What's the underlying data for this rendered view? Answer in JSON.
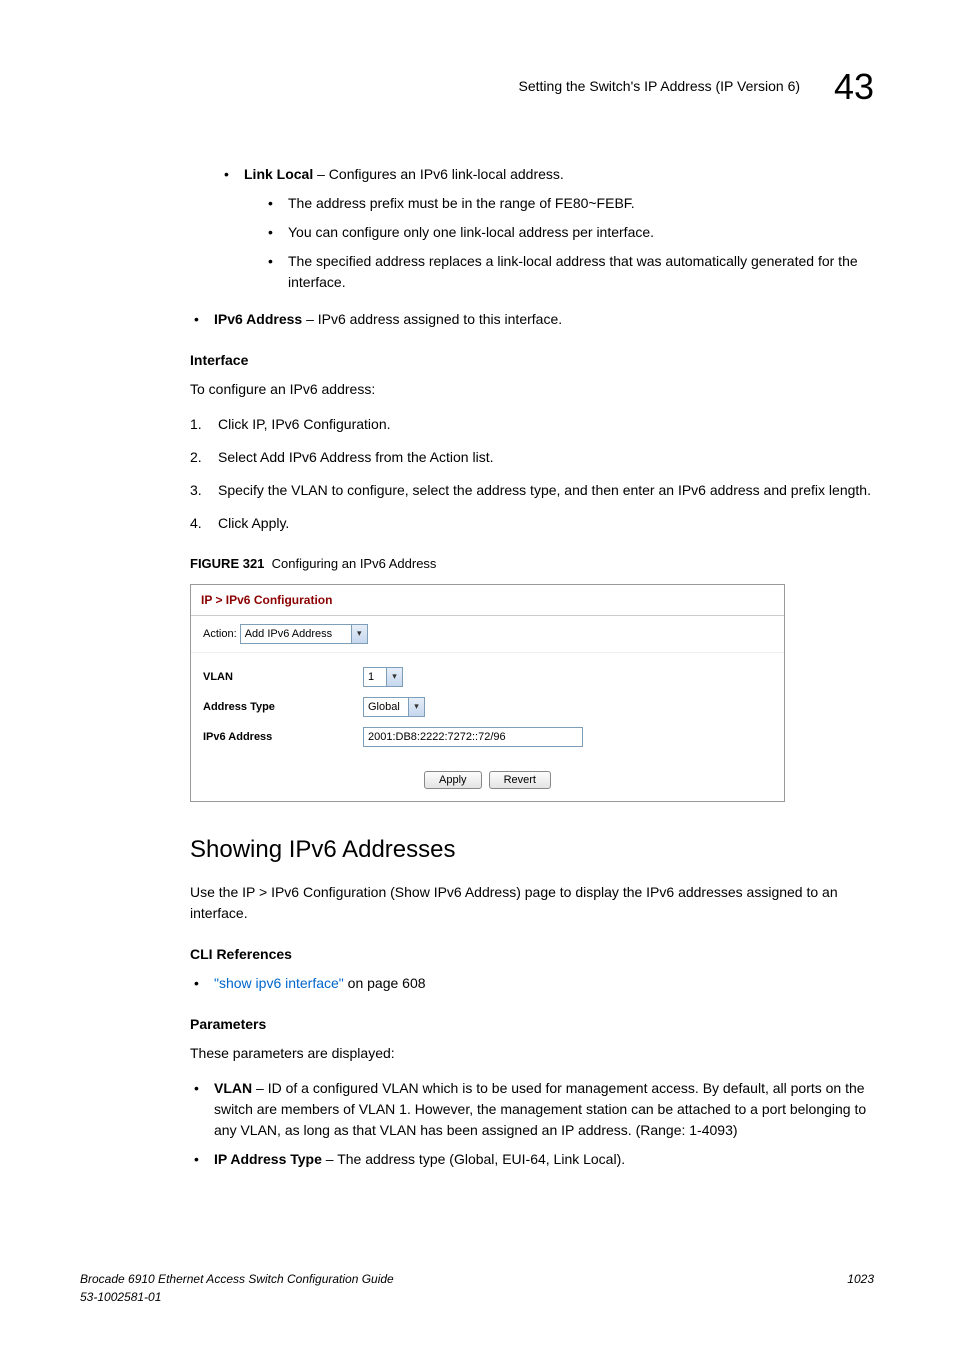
{
  "header": {
    "title": "Setting the Switch's IP Address (IP Version 6)",
    "chapter": "43"
  },
  "top_bullets": {
    "link_local_label": "Link Local",
    "link_local_desc": " – Configures an IPv6 link-local address.",
    "sub1": "The address prefix must be in the range of FE80~FEBF.",
    "sub2": "You can configure only one link-local address per interface.",
    "sub3": "The specified address replaces a link-local address that was automatically generated for the interface.",
    "ipv6_addr_label": "IPv6 Address",
    "ipv6_addr_desc": " – IPv6 address assigned to this interface."
  },
  "interface_section": {
    "heading": "Interface",
    "intro": "To configure an IPv6 address:",
    "steps": {
      "s1": "Click IP, IPv6 Configuration.",
      "s2": "Select Add IPv6 Address from the Action list.",
      "s3": "Specify the VLAN to configure, select the address type, and then enter an IPv6 address and prefix length.",
      "s4": "Click Apply."
    }
  },
  "figure": {
    "caption_prefix": "FIGURE 321",
    "caption_text": "Configuring an IPv6 Address",
    "breadcrumb": "IP > IPv6 Configuration",
    "action_label": "Action:",
    "action_value": "Add IPv6 Address",
    "vlan_label": "VLAN",
    "vlan_value": "1",
    "addrtype_label": "Address Type",
    "addrtype_value": "Global",
    "ipv6addr_label": "IPv6 Address",
    "ipv6addr_value": "2001:DB8:2222:7272::72/96",
    "apply": "Apply",
    "revert": "Revert"
  },
  "showing_section": {
    "heading": "Showing IPv6 Addresses",
    "intro": "Use the IP > IPv6 Configuration (Show IPv6 Address) page to display the IPv6 addresses assigned to an interface.",
    "cli_heading": "CLI References",
    "cli_link": "\"show ipv6 interface\"",
    "cli_suffix": " on page 608",
    "params_heading": "Parameters",
    "params_intro": "These parameters are displayed:",
    "vlan_label": "VLAN",
    "vlan_desc": " – ID of a configured VLAN which is to be used for management access. By default, all ports on the switch are members of VLAN 1. However, the management station can be attached to a port belonging to any VLAN, as long as that VLAN has been assigned an IP address. (Range: 1-4093)",
    "iptype_label": "IP Address Type",
    "iptype_desc": " – The address type (Global, EUI-64, Link Local)."
  },
  "footer": {
    "left1": "Brocade 6910 Ethernet Access Switch Configuration Guide",
    "left2": "53-1002581-01",
    "right": "1023"
  }
}
